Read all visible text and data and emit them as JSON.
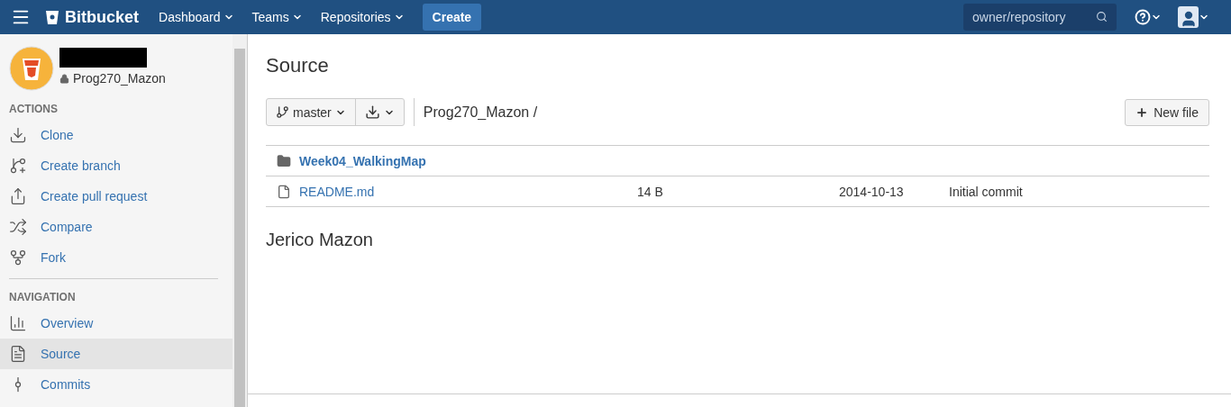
{
  "topbar": {
    "logo": "Bitbucket",
    "menus": [
      {
        "label": "Dashboard"
      },
      {
        "label": "Teams"
      },
      {
        "label": "Repositories"
      }
    ],
    "create": "Create",
    "search": {
      "placeholder": "owner/repository"
    }
  },
  "sidebar": {
    "repo": "Prog270_Mazon",
    "private": true,
    "sections": [
      {
        "title": "ACTIONS",
        "items": [
          {
            "label": "Clone",
            "kind": "clone",
            "selected": false
          },
          {
            "label": "Create branch",
            "kind": "branch",
            "selected": false
          },
          {
            "label": "Create pull request",
            "kind": "pull",
            "selected": false
          },
          {
            "label": "Compare",
            "kind": "compare",
            "selected": false
          },
          {
            "label": "Fork",
            "kind": "fork",
            "selected": false
          }
        ]
      },
      {
        "title": "NAVIGATION",
        "items": [
          {
            "label": "Overview",
            "kind": "overview",
            "selected": false
          },
          {
            "label": "Source",
            "kind": "source",
            "selected": true
          },
          {
            "label": "Commits",
            "kind": "commits",
            "selected": false
          }
        ]
      }
    ]
  },
  "main": {
    "title": "Source",
    "branch": "master",
    "breadcrumb": "Prog270_Mazon /",
    "new_file": "New file",
    "files": [
      {
        "kind": "folder",
        "name": "Week04_WalkingMap"
      },
      {
        "kind": "file",
        "name": "README.md",
        "size": "14 B",
        "date": "2014-10-13",
        "message": "Initial commit"
      }
    ],
    "readme_heading": "Jerico Mazon"
  }
}
